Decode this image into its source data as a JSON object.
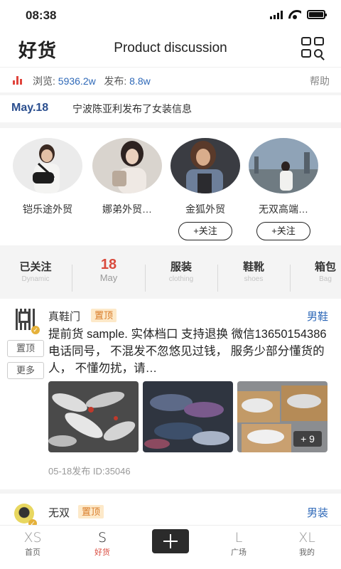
{
  "status": {
    "time": "08:38"
  },
  "header": {
    "brand": "好货",
    "title": "Product discussion"
  },
  "stats": {
    "views_label": "浏览:",
    "views_value": "5936.2w",
    "posts_label": "发布:",
    "posts_value": "8.8w",
    "help": "帮助"
  },
  "news": {
    "date": "May.18",
    "message": "宁波陈亚利发布了女装信息"
  },
  "sellers": [
    {
      "name": "铠乐途外贸",
      "follow": ""
    },
    {
      "name": "娜弟外贸…",
      "follow": ""
    },
    {
      "name": "金狐外贸",
      "follow": "+关注"
    },
    {
      "name": "无双高端…",
      "follow": "+关注"
    }
  ],
  "categories": [
    {
      "zh": "已关注",
      "en": "Dynamic"
    },
    {
      "zh": "18",
      "en": "May"
    },
    {
      "zh": "服装",
      "en": "clothing"
    },
    {
      "zh": "鞋靴",
      "en": "shoes"
    },
    {
      "zh": "箱包",
      "en": "Bag"
    }
  ],
  "post": {
    "poster": "真鞋门",
    "tag": "置顶",
    "category": "男鞋",
    "pin_button": "置顶",
    "more_button": "更多",
    "text": "提前货 sample. 实体档口 支持退换 微信13650154386电话同号， 不混发不忽悠见过钱， 服务少部分懂货的人， 不懂勿扰，请…",
    "more_photos": "+ 9",
    "meta": "05-18发布 ID:35046"
  },
  "post2": {
    "poster": "无双",
    "tag": "置顶",
    "category": "男装"
  },
  "tabs": [
    {
      "size": "XS",
      "label": "首页"
    },
    {
      "size": "S",
      "label": "好货"
    },
    {
      "size": "L",
      "label": "广场"
    },
    {
      "size": "XL",
      "label": "我的"
    }
  ],
  "colors": {
    "accent": "#d94a3d",
    "link": "#2f69b8",
    "tag_bg": "#fde9c9",
    "tag_text": "#d97b27"
  }
}
